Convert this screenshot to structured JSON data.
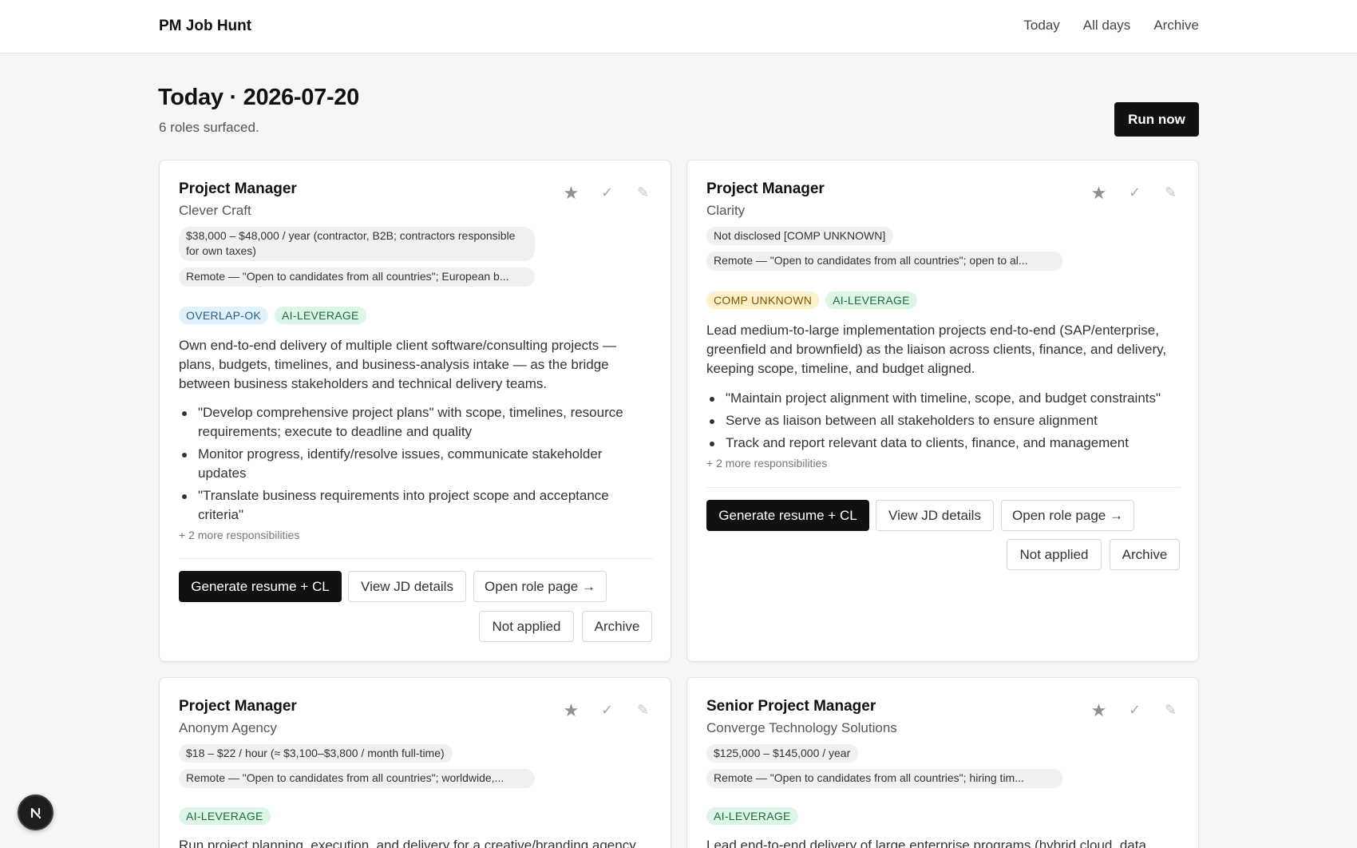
{
  "header": {
    "brand": "PM Job Hunt",
    "nav": [
      "Today",
      "All days",
      "Archive"
    ]
  },
  "page": {
    "title": "Today · 2026-07-20",
    "subtitle": "6 roles surfaced.",
    "run_label": "Run now"
  },
  "card_actions": {
    "generate": "Generate resume + CL",
    "view": "View JD details",
    "open": "Open role page →",
    "not_applied": "Not applied",
    "archive": "Archive"
  },
  "icons": [
    "star-icon",
    "check-icon",
    "pencil-icon",
    "next-logo-icon"
  ],
  "colors": {
    "primary": "#111111",
    "tag_blue_bg": "#e2f1fb",
    "tag_green_bg": "#dcf5e6",
    "tag_yellow_bg": "#fdf0c9"
  },
  "cards": [
    {
      "title": "Project Manager",
      "company": "Clever Craft",
      "comp": "$38,000 – $48,000 / year (contractor, B2B; contractors responsible for own taxes)",
      "location": "Remote — \"Open to candidates from all countries\"; European b...",
      "tags": [
        "OVERLAP-OK",
        "AI-LEVERAGE"
      ],
      "description": "Own end-to-end delivery of multiple client software/consulting projects — plans, budgets, timelines, and business-analysis intake — as the bridge between business stakeholders and technical delivery teams.",
      "responsibilities": [
        "\"Develop comprehensive project plans\" with scope, timelines, resource requirements; execute to deadline and quality",
        "Monitor progress, identify/resolve issues, communicate stakeholder updates",
        "\"Translate business requirements into project scope and acceptance criteria\""
      ],
      "more": "+ 2 more responsibilities"
    },
    {
      "title": "Project Manager",
      "company": "Clarity",
      "comp": "Not disclosed [COMP UNKNOWN]",
      "location": "Remote — \"Open to candidates from all countries\"; open to al...",
      "tags": [
        "COMP UNKNOWN",
        "AI-LEVERAGE"
      ],
      "description": "Lead medium-to-large implementation projects end-to-end (SAP/enterprise, greenfield and brownfield) as the liaison across clients, finance, and delivery, keeping scope, timeline, and budget aligned.",
      "responsibilities": [
        "\"Maintain project alignment with timeline, scope, and budget constraints\"",
        "Serve as liaison between all stakeholders to ensure alignment",
        "Track and report relevant data to clients, finance, and management"
      ],
      "more": "+ 2 more responsibilities"
    },
    {
      "title": "Project Manager",
      "company": "Anonym Agency",
      "comp": "$18 – $22 / hour (≈ $3,100–$3,800 / month full-time)",
      "location": "Remote — \"Open to candidates from all countries\"; worldwide,...",
      "tags": [
        "AI-LEVERAGE"
      ],
      "description": "Run project planning, execution, and delivery for a creative/branding agency"
    },
    {
      "title": "Senior Project Manager",
      "company": "Converge Technology Solutions",
      "comp": "$125,000 – $145,000 / year",
      "location": "Remote — \"Open to candidates from all countries\"; hiring tim...",
      "tags": [
        "AI-LEVERAGE"
      ],
      "description": "Lead end-to-end delivery of large enterprise programs (hybrid cloud, data"
    }
  ]
}
